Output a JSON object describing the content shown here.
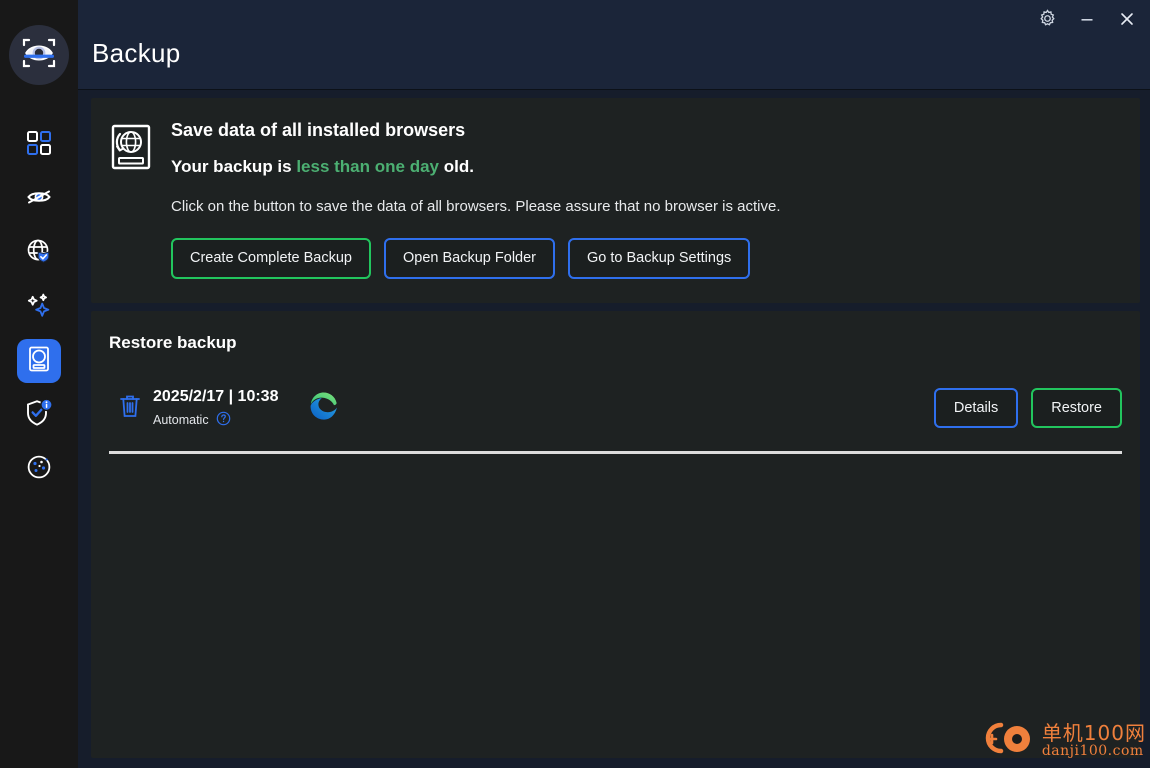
{
  "app": {
    "logo_icon": "eye-scan-logo",
    "accent_blue": "#2f6fed",
    "accent_green": "#22c55e",
    "text_green": "#4caf72"
  },
  "titlebar": {
    "title": "Backup",
    "settings_icon": "gear-icon",
    "minimize_icon": "minimize-icon",
    "close_icon": "close-icon"
  },
  "sidebar": {
    "items": [
      {
        "icon": "dashboard-grid-icon",
        "name": "dashboard",
        "active": false
      },
      {
        "icon": "eye-off-icon",
        "name": "tracking",
        "active": false
      },
      {
        "icon": "globe-shield-icon",
        "name": "browser-protection",
        "active": false
      },
      {
        "icon": "sparkles-icon",
        "name": "cleanup",
        "active": false
      },
      {
        "icon": "hard-drive-icon",
        "name": "backup",
        "active": true
      },
      {
        "icon": "shield-check-info-icon",
        "name": "security-info",
        "active": false
      },
      {
        "icon": "cookie-icon",
        "name": "cookies",
        "active": false
      }
    ]
  },
  "backup_card": {
    "icon": "backup-drive-globe-icon",
    "heading": "Save data of all installed browsers",
    "status_prefix": "Your backup is ",
    "status_accent": "less than one day",
    "status_suffix": " old.",
    "description": "Click on the button to save the data of all browsers. Please assure that no browser is active.",
    "buttons": [
      {
        "label": "Create Complete Backup",
        "style": "green"
      },
      {
        "label": "Open Backup Folder",
        "style": "blue"
      },
      {
        "label": "Go to Backup Settings",
        "style": "blue"
      }
    ]
  },
  "restore_card": {
    "title": "Restore backup",
    "rows": [
      {
        "delete_icon": "trash-icon",
        "date": "2025/2/17 | 10:38",
        "type": "Automatic",
        "help_icon": "help-circle-icon",
        "browser_icon": "edge-browser-icon",
        "details_label": "Details",
        "restore_label": "Restore"
      }
    ]
  },
  "watermark": {
    "icon": "danji100-logo",
    "cn": "单机100网",
    "en": "danji100.com",
    "color": "#f0803c"
  }
}
